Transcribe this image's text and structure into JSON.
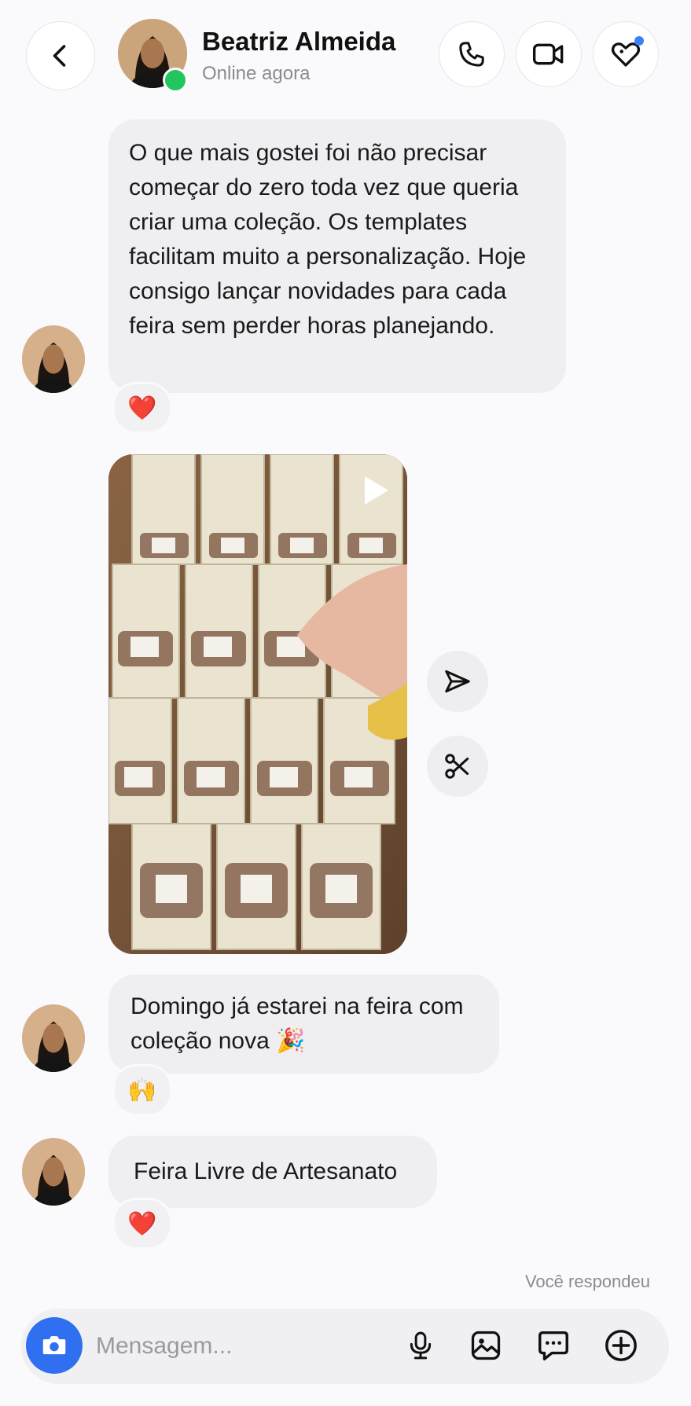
{
  "header": {
    "contact_name": "Beatriz Almeida",
    "status": "Online agora",
    "icons": [
      "back-chevron-icon",
      "phone-icon",
      "video-camera-icon",
      "heart-tag-icon"
    ],
    "online_color": "#22c55e",
    "notification_dot_color": "#3b82f6"
  },
  "messages": [
    {
      "text": "O que mais gostei foi não precisar começar do zero toda vez que queria criar uma coleção. Os templates facilitam muito a personalização. Hoje consigo lançar novidades para cada feira sem perder horas planejando.",
      "reaction": "❤️"
    },
    {
      "type": "video",
      "actions": [
        "send-icon",
        "scissors-icon"
      ]
    },
    {
      "text": "Domingo já estarei na feira com coleção nova 🎉",
      "reaction": "🙌"
    },
    {
      "text": "Feira Livre de Artesanato",
      "reaction": "❤️"
    }
  ],
  "footer_note": "Você respondeu",
  "composer": {
    "placeholder": "Mensagem...",
    "icons": [
      "camera-icon",
      "microphone-icon",
      "image-icon",
      "chat-bubble-icon",
      "plus-circle-icon"
    ],
    "camera_color": "#2f6ff0"
  }
}
